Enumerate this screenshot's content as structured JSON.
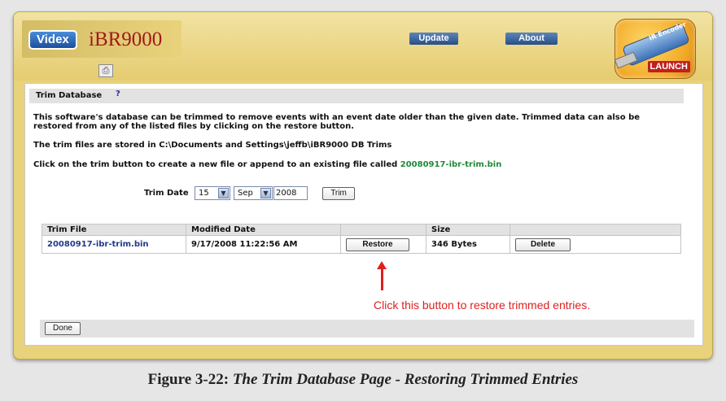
{
  "header": {
    "brand": "Videx",
    "product": "iBR9000",
    "nav": {
      "update": "Update",
      "about": "About"
    },
    "launch": {
      "usb_text": "IR Encoder",
      "label": "LAUNCH"
    },
    "print_icon": "printer-icon"
  },
  "section": {
    "title": "Trim Database",
    "help": "?"
  },
  "text": {
    "p1": "This software's database can be trimmed to remove events with an event date older than the given date. Trimmed data can also be restored from any of the listed files by clicking on the restore button.",
    "p2": "The trim files are stored in C:\\Documents and Settings\\jeffb\\iBR9000 DB Trims",
    "p3_prefix": "Click on the trim button to create a new file or append to an existing file called ",
    "p3_file": "20080917-ibr-trim.bin"
  },
  "trim": {
    "label": "Trim Date",
    "day": "15",
    "month": "Sep",
    "year": "2008",
    "button": "Trim"
  },
  "table": {
    "headers": [
      "Trim File",
      "Modified Date",
      "",
      "Size",
      ""
    ],
    "rows": [
      {
        "file": "20080917-ibr-trim.bin",
        "modified": "9/17/2008 11:22:56 AM",
        "restore": "Restore",
        "size": "346 Bytes",
        "delete": "Delete"
      }
    ]
  },
  "callout": "Click this button to restore trimmed entries.",
  "done": "Done",
  "caption": {
    "label": "Figure 3-22:",
    "title": "The Trim Database Page - Restoring Trimmed Entries"
  },
  "colors": {
    "accent_red": "#e02020",
    "link_green": "#1f8a35",
    "frame": "#e9d27c"
  }
}
